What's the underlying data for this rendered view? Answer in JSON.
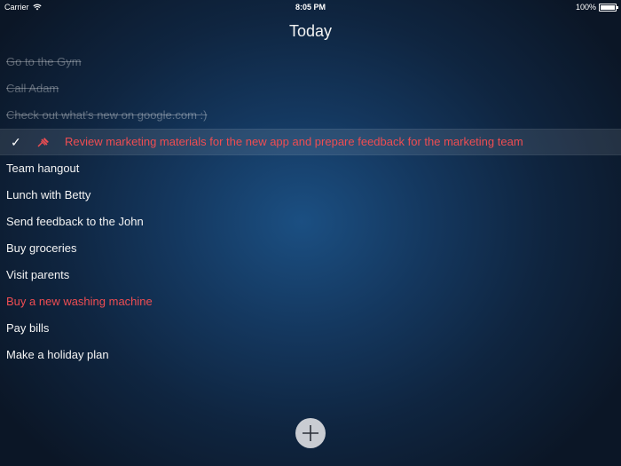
{
  "status_bar": {
    "carrier": "Carrier",
    "time": "8:05 PM",
    "battery": "100%"
  },
  "header": {
    "title": "Today"
  },
  "tasks": [
    {
      "label": "Go to the Gym",
      "state": "done"
    },
    {
      "label": "Call Adam",
      "state": "done"
    },
    {
      "label": "Check out what's new on google.com :)",
      "state": "done"
    },
    {
      "label": "Review marketing materials for the new app and prepare feedback for the marketing team",
      "state": "selected",
      "priority": true
    },
    {
      "label": "Team hangout",
      "state": "normal"
    },
    {
      "label": "Lunch with Betty",
      "state": "normal"
    },
    {
      "label": "Send feedback to the John",
      "state": "normal"
    },
    {
      "label": "Buy groceries",
      "state": "normal"
    },
    {
      "label": "Visit parents",
      "state": "normal"
    },
    {
      "label": "Buy a new washing machine",
      "state": "normal",
      "priority": true
    },
    {
      "label": "Pay bills",
      "state": "normal"
    },
    {
      "label": "Make a holiday plan",
      "state": "normal"
    }
  ],
  "selected_row": {
    "check_glyph": "✓",
    "icons": [
      "check-icon",
      "pin-icon"
    ]
  },
  "footer": {
    "add_icon": "plus-icon"
  },
  "colors": {
    "priority": "#ee4d52",
    "background": "#14375e",
    "add_button": "#c9ccd2"
  }
}
